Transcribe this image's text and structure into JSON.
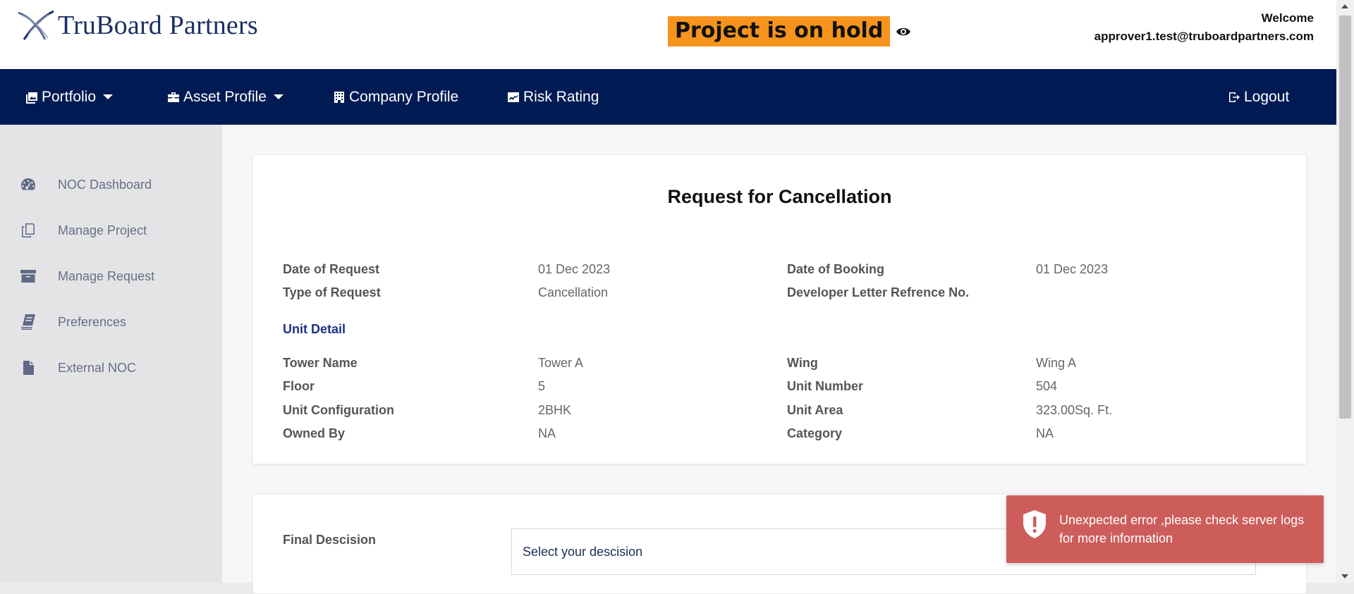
{
  "header": {
    "logo_text": "TruBoard Partners",
    "status_banner": "Project is on hold",
    "welcome": "Welcome",
    "user_email": "approver1.test@truboardpartners.com"
  },
  "nav": {
    "portfolio": "Portfolio",
    "asset_profile": "Asset Profile",
    "company_profile": "Company Profile",
    "risk_rating": "Risk Rating",
    "logout": "Logout"
  },
  "sidebar": {
    "items": [
      {
        "label": "NOC Dashboard",
        "icon": "gauge-icon"
      },
      {
        "label": "Manage Project",
        "icon": "copy-icon"
      },
      {
        "label": "Manage Request",
        "icon": "archive-icon"
      },
      {
        "label": "Preferences",
        "icon": "book-icon"
      },
      {
        "label": "External NOC",
        "icon": "file-icon"
      }
    ]
  },
  "request": {
    "title": "Request for Cancellation",
    "date_of_request_label": "Date of Request",
    "date_of_request": "01 Dec 2023",
    "type_of_request_label": "Type of Request",
    "type_of_request": "Cancellation",
    "date_of_booking_label": "Date of Booking",
    "date_of_booking": "01 Dec 2023",
    "developer_letter_label": "Developer Letter Refrence No.",
    "developer_letter": "",
    "unit_detail_heading": "Unit Detail",
    "tower_name_label": "Tower Name",
    "tower_name": "Tower A",
    "wing_label": "Wing",
    "wing": "Wing A",
    "floor_label": "Floor",
    "floor": "5",
    "unit_number_label": "Unit Number",
    "unit_number": "504",
    "unit_config_label": "Unit Configuration",
    "unit_config": "2BHK",
    "unit_area_label": "Unit Area",
    "unit_area": "323.00Sq. Ft.",
    "owned_by_label": "Owned By",
    "owned_by": "NA",
    "category_label": "Category",
    "category": "NA"
  },
  "decision": {
    "label": "Final Descision",
    "placeholder": "Select your descision"
  },
  "toast": {
    "message": "Unexpected error ,please check server logs for more information"
  },
  "colors": {
    "nav_bg": "#001b54",
    "hold_banner": "#f7941d",
    "toast_bg": "#cd5d5b",
    "section_heading": "#1c3385"
  }
}
